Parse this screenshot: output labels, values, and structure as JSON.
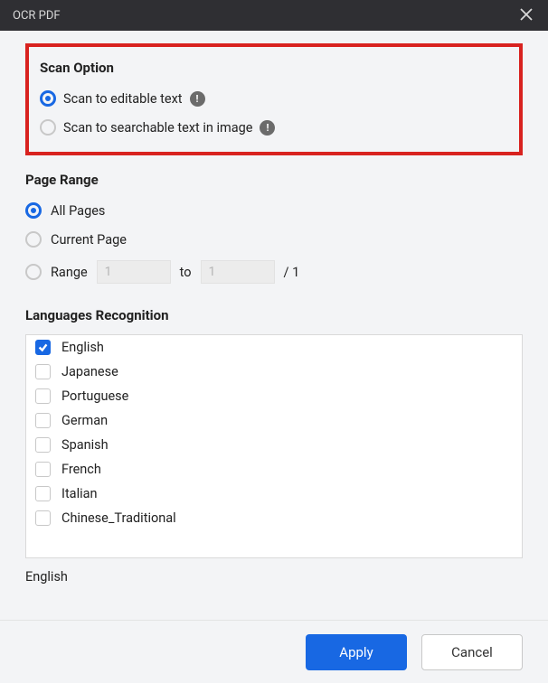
{
  "title": "OCR PDF",
  "scan_option": {
    "title": "Scan Option",
    "options": [
      {
        "label": "Scan to editable text",
        "selected": true,
        "info": true
      },
      {
        "label": "Scan to searchable text in image",
        "selected": false,
        "info": true
      }
    ]
  },
  "page_range": {
    "title": "Page Range",
    "options": {
      "all": {
        "label": "All Pages",
        "selected": true
      },
      "current": {
        "label": "Current Page",
        "selected": false
      },
      "range": {
        "label": "Range",
        "selected": false,
        "from": "1",
        "to_label": "to",
        "to": "1",
        "total_prefix": "/",
        "total": "1"
      }
    }
  },
  "languages": {
    "title": "Languages Recognition",
    "items": [
      {
        "label": "English",
        "checked": true
      },
      {
        "label": "Japanese",
        "checked": false
      },
      {
        "label": "Portuguese",
        "checked": false
      },
      {
        "label": "German",
        "checked": false
      },
      {
        "label": "Spanish",
        "checked": false
      },
      {
        "label": "French",
        "checked": false
      },
      {
        "label": "Italian",
        "checked": false
      },
      {
        "label": "Chinese_Traditional",
        "checked": false
      }
    ],
    "selected_summary": "English"
  },
  "footer": {
    "apply": "Apply",
    "cancel": "Cancel"
  }
}
